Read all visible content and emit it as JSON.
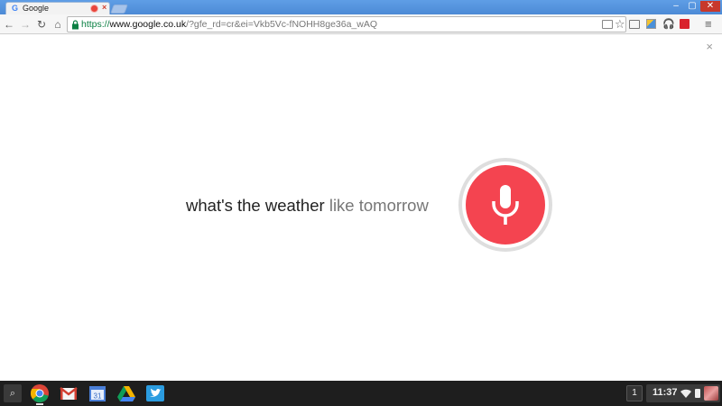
{
  "browser": {
    "tab": {
      "favicon": "G",
      "title": "Google",
      "close_glyph": "×"
    },
    "window_controls": {
      "minimize": "–",
      "maximize": "▢",
      "close": "✕"
    },
    "nav": {
      "back": "←",
      "forward": "→",
      "reload": "↻",
      "home": "⌂"
    },
    "url": {
      "scheme": "https://",
      "host": "www.google.co.uk",
      "path": "/?gfe_rd=cr&ei=Vkb5Vc-fNOHH8ge36a_wAQ"
    },
    "star": "☆",
    "menu": "≡",
    "ext_3_glyph": "🎧"
  },
  "voice_search": {
    "close": "×",
    "query_final": "what's the weather",
    "query_interim": " like tomorrow",
    "mic_color": "#f44450"
  },
  "shelf": {
    "launcher": "⌕",
    "apps": [
      "chrome",
      "gmail",
      "calendar",
      "drive",
      "twitter"
    ],
    "calendar_day": "31",
    "notification_count": "1",
    "clock": "11:37"
  }
}
